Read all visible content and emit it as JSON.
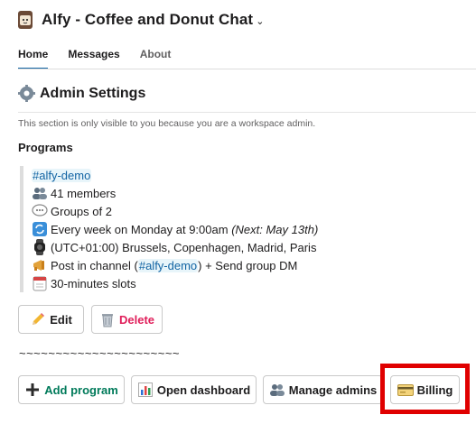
{
  "app": {
    "title": "Alfy - Coffee and Donut Chat",
    "icon": "coffee-cup-icon"
  },
  "tabs": [
    {
      "label": "Home",
      "active": true
    },
    {
      "label": "Messages",
      "active": false
    },
    {
      "label": "About",
      "active": false
    }
  ],
  "admin": {
    "title": "Admin Settings",
    "icon": "gear-icon",
    "note": "This section is only visible to you because you are a workspace admin."
  },
  "programs": {
    "label": "Programs",
    "channel": "#alfy-demo",
    "members": "41 members",
    "groups": "Groups of 2",
    "schedule": "Every week on Monday at 9:00am",
    "schedule_next": "(Next: May 13th)",
    "timezone": "(UTC+01:00) Brussels, Copenhagen, Madrid, Paris",
    "post_prefix": "Post in channel (",
    "post_channel": "#alfy-demo",
    "post_suffix": ") + Send group DM",
    "slots": "30-minutes slots"
  },
  "buttons": {
    "edit": "Edit",
    "delete": "Delete",
    "add_program": "Add program",
    "open_dashboard": "Open dashboard",
    "manage_admins": "Manage admins",
    "billing": "Billing"
  },
  "divider": "~~~~~~~~~~~~~~~~~~~~~~",
  "colors": {
    "link": "#1264a3",
    "green": "#007a5a",
    "danger": "#e01e5a",
    "highlight": "#e00000"
  }
}
